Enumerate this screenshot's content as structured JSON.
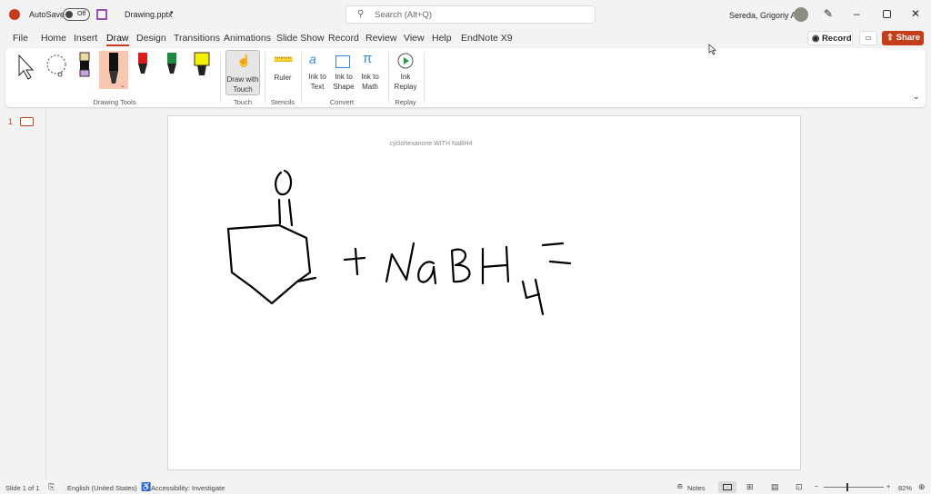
{
  "titlebar": {
    "autosave_label": "AutoSave",
    "autosave_state": "Off",
    "filename": "Drawing.pptx",
    "search_placeholder": "Search (Alt+Q)",
    "user": "Sereda, Grigoriy A"
  },
  "tabs": [
    "File",
    "Home",
    "Insert",
    "Draw",
    "Design",
    "Transitions",
    "Animations",
    "Slide Show",
    "Record",
    "Review",
    "View",
    "Help",
    "EndNote X9"
  ],
  "actions": {
    "record": "Record",
    "share": "Share"
  },
  "ribbon": {
    "groups": {
      "drawing_tools": "Drawing Tools",
      "touch": "Touch",
      "stencils": "Stencils",
      "convert": "Convert",
      "replay": "Replay"
    },
    "buttons": {
      "draw_with_touch": "Draw with Touch",
      "ruler": "Ruler",
      "ink_to_text": "Ink to Text",
      "ink_to_shape": "Ink to Shape",
      "ink_to_math": "Ink to Math",
      "ink_replay": "Ink Replay"
    }
  },
  "thumbnails": {
    "slide_number": "1"
  },
  "slide": {
    "caption": "cyclohexanone WITH NaBH4"
  },
  "status": {
    "slide": "Slide 1 of 1",
    "language": "English (United States)",
    "accessibility": "Accessibility: Investigate",
    "notes": "Notes",
    "zoom": "82%",
    "zoom_fraction": 0.4
  },
  "colors": {
    "accent": "#c43e1c",
    "share": "#c43e1c"
  }
}
